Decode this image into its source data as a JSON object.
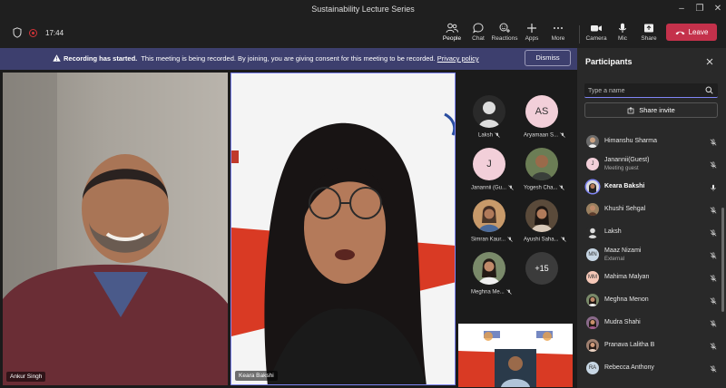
{
  "window": {
    "title": "Sustainability Lecture Series"
  },
  "meeting": {
    "timer": "17:44"
  },
  "toolbar": {
    "buttons": [
      {
        "label": "People",
        "icon": "people-icon",
        "active": true
      },
      {
        "label": "Chat",
        "icon": "chat-icon"
      },
      {
        "label": "Reactions",
        "icon": "reactions-icon"
      },
      {
        "label": "Apps",
        "icon": "apps-icon"
      },
      {
        "label": "More",
        "icon": "more-icon"
      },
      {
        "label": "Camera",
        "icon": "camera-icon"
      },
      {
        "label": "Mic",
        "icon": "mic-icon"
      },
      {
        "label": "Share",
        "icon": "share-icon"
      }
    ],
    "leave_label": "Leave",
    "leave_color": "#c4314b"
  },
  "banner": {
    "bold": "Recording has started.",
    "text": "This meeting is being recorded. By joining, you are giving consent for this meeting to be recorded.",
    "link": "Privacy policy",
    "dismiss": "Dismiss",
    "bg": "#3d3f6e"
  },
  "stage": {
    "main_tiles": [
      {
        "name": "Ankur Singh"
      },
      {
        "name": "Keara Bakshi"
      }
    ],
    "gallery": [
      {
        "label": "Laksh",
        "initials": "",
        "muted": true
      },
      {
        "label": "Aryamaan S...",
        "initials": "AS",
        "muted": true
      },
      {
        "label": "Janannii (Gu...",
        "initials": "J",
        "muted": true
      },
      {
        "label": "Yogesh Cha...",
        "initials": "",
        "muted": true
      },
      {
        "label": "Simran Kaur...",
        "initials": "",
        "muted": true
      },
      {
        "label": "Ayushi Saha...",
        "initials": "",
        "muted": true
      },
      {
        "label": "Meghna Me...",
        "initials": "",
        "muted": true
      }
    ],
    "overflow": "+15"
  },
  "participants": {
    "title": "Participants",
    "search_placeholder": "Type a name",
    "share_invite": "Share invite",
    "list": [
      {
        "name": "Himanshu Sharma",
        "initials": "",
        "sub": "",
        "muted": true
      },
      {
        "name": "Janannii(Guest)",
        "initials": "J",
        "sub": "Meeting guest",
        "muted": true
      },
      {
        "name": "Keara Bakshi",
        "initials": "",
        "sub": "",
        "muted": false,
        "speaking": true
      },
      {
        "name": "Khushi Sehgal",
        "initials": "",
        "sub": "",
        "muted": true
      },
      {
        "name": "Laksh",
        "initials": "",
        "sub": "",
        "muted": true
      },
      {
        "name": "Maaz Nizami",
        "initials": "MN",
        "sub": "External",
        "muted": true
      },
      {
        "name": "Mahima Malyan",
        "initials": "MM",
        "sub": "",
        "muted": true
      },
      {
        "name": "Meghna Menon",
        "initials": "",
        "sub": "",
        "muted": true
      },
      {
        "name": "Mudra Shahi",
        "initials": "",
        "sub": "",
        "muted": true
      },
      {
        "name": "Pranava Lalitha B",
        "initials": "",
        "sub": "",
        "muted": true
      },
      {
        "name": "Rebecca Anthony",
        "initials": "RA",
        "sub": "",
        "muted": true
      }
    ]
  }
}
